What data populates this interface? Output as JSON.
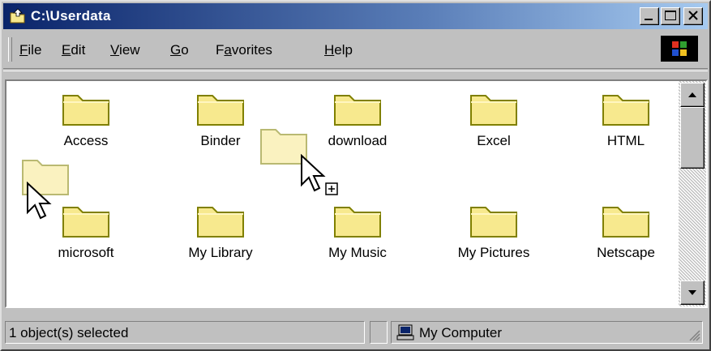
{
  "window": {
    "title": "C:\\Userdata",
    "minimize_label": "_",
    "maximize_label": "□",
    "close_label": "×"
  },
  "menu": {
    "items": [
      {
        "key": "F",
        "rest": "ile"
      },
      {
        "key": "E",
        "rest": "dit"
      },
      {
        "key": "V",
        "rest": "iew"
      },
      {
        "key": "G",
        "rest": "o"
      },
      {
        "pre": "F",
        "key": "a",
        "rest": "vorites"
      },
      {
        "key": "H",
        "rest": "elp"
      }
    ]
  },
  "folders": [
    {
      "name": "Access"
    },
    {
      "name": "Binder"
    },
    {
      "name": "download"
    },
    {
      "name": "Excel"
    },
    {
      "name": "HTML"
    },
    {
      "name": "microsoft"
    },
    {
      "name": "My Library"
    },
    {
      "name": "My Music"
    },
    {
      "name": "My Pictures"
    },
    {
      "name": "Netscape"
    }
  ],
  "status": {
    "selection": "1 object(s) selected",
    "location": "My Computer"
  },
  "colors": {
    "folder_fill": "#f7e98e",
    "folder_edge": "#808000",
    "titlebar_start": "#0a246a",
    "titlebar_end": "#a6caf0"
  },
  "icons": {
    "title": "folder-up-icon",
    "folder": "folder-icon",
    "cursor": "arrow-cursor-icon",
    "computer": "my-computer-icon"
  }
}
